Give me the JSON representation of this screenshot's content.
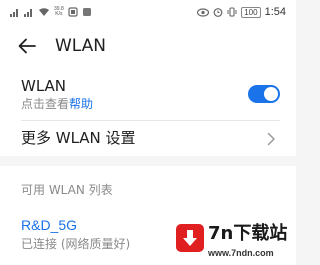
{
  "status_bar": {
    "speed_value": "39.8",
    "speed_unit": "K/s",
    "battery": "100",
    "time": "1:54"
  },
  "header": {
    "back_icon": "arrow-left-icon",
    "title": "WLAN"
  },
  "wlan_toggle": {
    "label": "WLAN",
    "subtitle_prefix": "点击查看",
    "subtitle_link": "帮助",
    "enabled": true,
    "color": "#1a73e8"
  },
  "more_settings": {
    "label": "更多 WLAN 设置",
    "icon": "chevron-right-icon"
  },
  "networks": {
    "section_title": "可用 WLAN 列表",
    "items": [
      {
        "name": "R&D_5G",
        "status": "已连接 (网络质量好)"
      }
    ]
  },
  "watermark": {
    "title": "7n下载站",
    "url": "www.7ndn.com"
  }
}
